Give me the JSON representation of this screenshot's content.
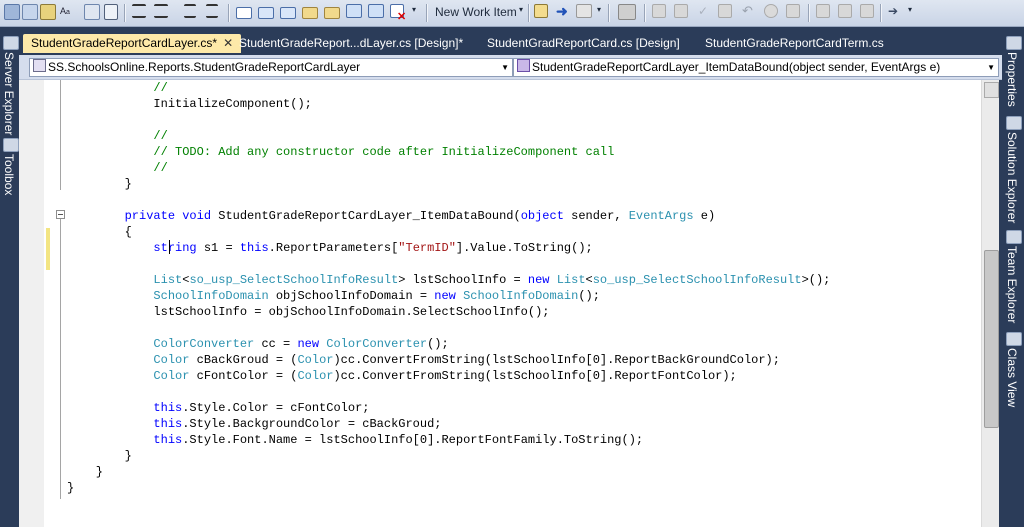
{
  "toolbar": {
    "new_work_item_label": "New Work Item"
  },
  "tool_windows_left": [
    {
      "label": "Server Explorer"
    },
    {
      "label": "Toolbox"
    }
  ],
  "tool_windows_right": [
    {
      "label": "Properties"
    },
    {
      "label": "Solution Explorer"
    },
    {
      "label": "Team Explorer"
    },
    {
      "label": "Class View"
    }
  ],
  "tabs": [
    {
      "label": "StudentGradeReportCardLayer.cs*",
      "active": true
    },
    {
      "label": "StudentGradeReport...dLayer.cs [Design]*"
    },
    {
      "label": "StudentGradReportCard.cs [Design]"
    },
    {
      "label": "StudentGradeReportCardTerm.cs"
    }
  ],
  "navbar": {
    "types_dropdown": "SS.SchoolsOnline.Reports.StudentGradeReportCardLayer",
    "members_dropdown": "StudentGradeReportCardLayer_ItemDataBound(object sender, EventArgs e)"
  },
  "code": {
    "lines": [
      [
        {
          "t": "            "
        },
        {
          "t": "//",
          "c": "cm"
        }
      ],
      [
        {
          "t": "            InitializeComponent();"
        }
      ],
      [
        {
          "t": ""
        }
      ],
      [
        {
          "t": "            "
        },
        {
          "t": "//",
          "c": "cm"
        }
      ],
      [
        {
          "t": "            "
        },
        {
          "t": "// TODO: Add any constructor code after InitializeComponent call",
          "c": "cm"
        }
      ],
      [
        {
          "t": "            "
        },
        {
          "t": "//",
          "c": "cm"
        }
      ],
      [
        {
          "t": "        }"
        }
      ],
      [
        {
          "t": ""
        }
      ],
      [
        {
          "t": "        "
        },
        {
          "t": "private",
          "c": "kw"
        },
        {
          "t": " "
        },
        {
          "t": "void",
          "c": "kw"
        },
        {
          "t": " StudentGradeReportCardLayer_ItemDataBound("
        },
        {
          "t": "object",
          "c": "kw"
        },
        {
          "t": " sender, "
        },
        {
          "t": "EventArgs",
          "c": "ty"
        },
        {
          "t": " e)"
        }
      ],
      [
        {
          "t": "        {"
        }
      ],
      [
        {
          "t": "            "
        },
        {
          "t": "string",
          "c": "kw"
        },
        {
          "t": " s1 = "
        },
        {
          "t": "this",
          "c": "kw"
        },
        {
          "t": ".ReportParameters["
        },
        {
          "t": "\"TermID\"",
          "c": "st"
        },
        {
          "t": "].Value.ToString();"
        }
      ],
      [
        {
          "t": ""
        }
      ],
      [
        {
          "t": "            "
        },
        {
          "t": "List",
          "c": "ty"
        },
        {
          "t": "<"
        },
        {
          "t": "so_usp_SelectSchoolInfoResult",
          "c": "ty"
        },
        {
          "t": "> lstSchoolInfo = "
        },
        {
          "t": "new",
          "c": "kw"
        },
        {
          "t": " "
        },
        {
          "t": "List",
          "c": "ty"
        },
        {
          "t": "<"
        },
        {
          "t": "so_usp_SelectSchoolInfoResult",
          "c": "ty"
        },
        {
          "t": ">();"
        }
      ],
      [
        {
          "t": "            "
        },
        {
          "t": "SchoolInfoDomain",
          "c": "ty"
        },
        {
          "t": " objSchoolInfoDomain = "
        },
        {
          "t": "new",
          "c": "kw"
        },
        {
          "t": " "
        },
        {
          "t": "SchoolInfoDomain",
          "c": "ty"
        },
        {
          "t": "();"
        }
      ],
      [
        {
          "t": "            lstSchoolInfo = objSchoolInfoDomain.SelectSchoolInfo();"
        }
      ],
      [
        {
          "t": ""
        }
      ],
      [
        {
          "t": "            "
        },
        {
          "t": "ColorConverter",
          "c": "ty"
        },
        {
          "t": " cc = "
        },
        {
          "t": "new",
          "c": "kw"
        },
        {
          "t": " "
        },
        {
          "t": "ColorConverter",
          "c": "ty"
        },
        {
          "t": "();"
        }
      ],
      [
        {
          "t": "            "
        },
        {
          "t": "Color",
          "c": "ty"
        },
        {
          "t": " cBackGroud = ("
        },
        {
          "t": "Color",
          "c": "ty"
        },
        {
          "t": ")cc.ConvertFromString(lstSchoolInfo[0].ReportBackGroundColor);"
        }
      ],
      [
        {
          "t": "            "
        },
        {
          "t": "Color",
          "c": "ty"
        },
        {
          "t": " cFontColor = ("
        },
        {
          "t": "Color",
          "c": "ty"
        },
        {
          "t": ")cc.ConvertFromString(lstSchoolInfo[0].ReportFontColor);"
        }
      ],
      [
        {
          "t": ""
        }
      ],
      [
        {
          "t": "            "
        },
        {
          "t": "this",
          "c": "kw"
        },
        {
          "t": ".Style.Color = cFontColor;"
        }
      ],
      [
        {
          "t": "            "
        },
        {
          "t": "this",
          "c": "kw"
        },
        {
          "t": ".Style.BackgroundColor = cBackGroud;"
        }
      ],
      [
        {
          "t": "            "
        },
        {
          "t": "this",
          "c": "kw"
        },
        {
          "t": ".Style.Font.Name = lstSchoolInfo[0].ReportFontFamily.ToString();"
        }
      ],
      [
        {
          "t": "        }"
        }
      ],
      [
        {
          "t": "    }"
        }
      ],
      [
        {
          "t": "}"
        }
      ]
    ]
  }
}
